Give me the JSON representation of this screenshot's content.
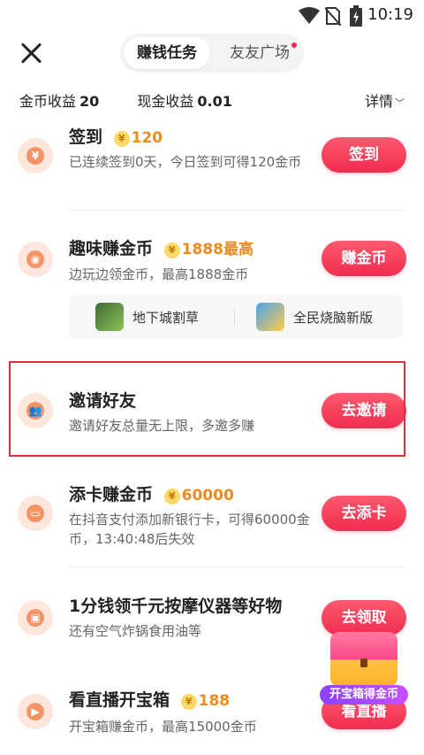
{
  "status": {
    "time": "10:19"
  },
  "header": {
    "tabs": [
      "赚钱任务",
      "友友广场"
    ]
  },
  "summary": {
    "gold_label": "金币收益",
    "gold_value": "20",
    "cash_label": "现金收益",
    "cash_value": "0.01",
    "details": "详情"
  },
  "tasks": [
    {
      "title": "签到",
      "coin": "¥",
      "reward": "120",
      "desc": "已连续签到0天，今日签到可得120金币",
      "button": "签到"
    },
    {
      "title": "趣味赚金币",
      "coin": "¥",
      "reward": "1888最高",
      "desc": "边玩边领金币，最高1888金币",
      "button": "赚金币"
    },
    {
      "title": "邀请好友",
      "coin": "",
      "reward": "",
      "desc": "邀请好友总量无上限，多邀多赚",
      "button": "去邀请"
    },
    {
      "title": "添卡赚金币",
      "coin": "¥",
      "reward": "60000",
      "desc": "在抖音支付添加新银行卡，可得60000金币，13:40:48后失效",
      "button": "去添卡"
    },
    {
      "title": "1分钱领千元按摩仪器等好物",
      "coin": "",
      "reward": "",
      "desc": "还有空气炸锅食用油等",
      "button": "去领取"
    },
    {
      "title": "看直播开宝箱",
      "coin": "¥",
      "reward": "188",
      "desc": "开宝箱赚金币，最高15000金币",
      "button": "看直播"
    }
  ],
  "games": [
    {
      "name": "地下城割草"
    },
    {
      "name": "全民烧脑新版"
    }
  ],
  "chest": {
    "label": "开宝箱得金币"
  },
  "colors": {
    "accent": "#f12c50",
    "reward": "#f08a1c",
    "highlight": "#e0303a"
  }
}
